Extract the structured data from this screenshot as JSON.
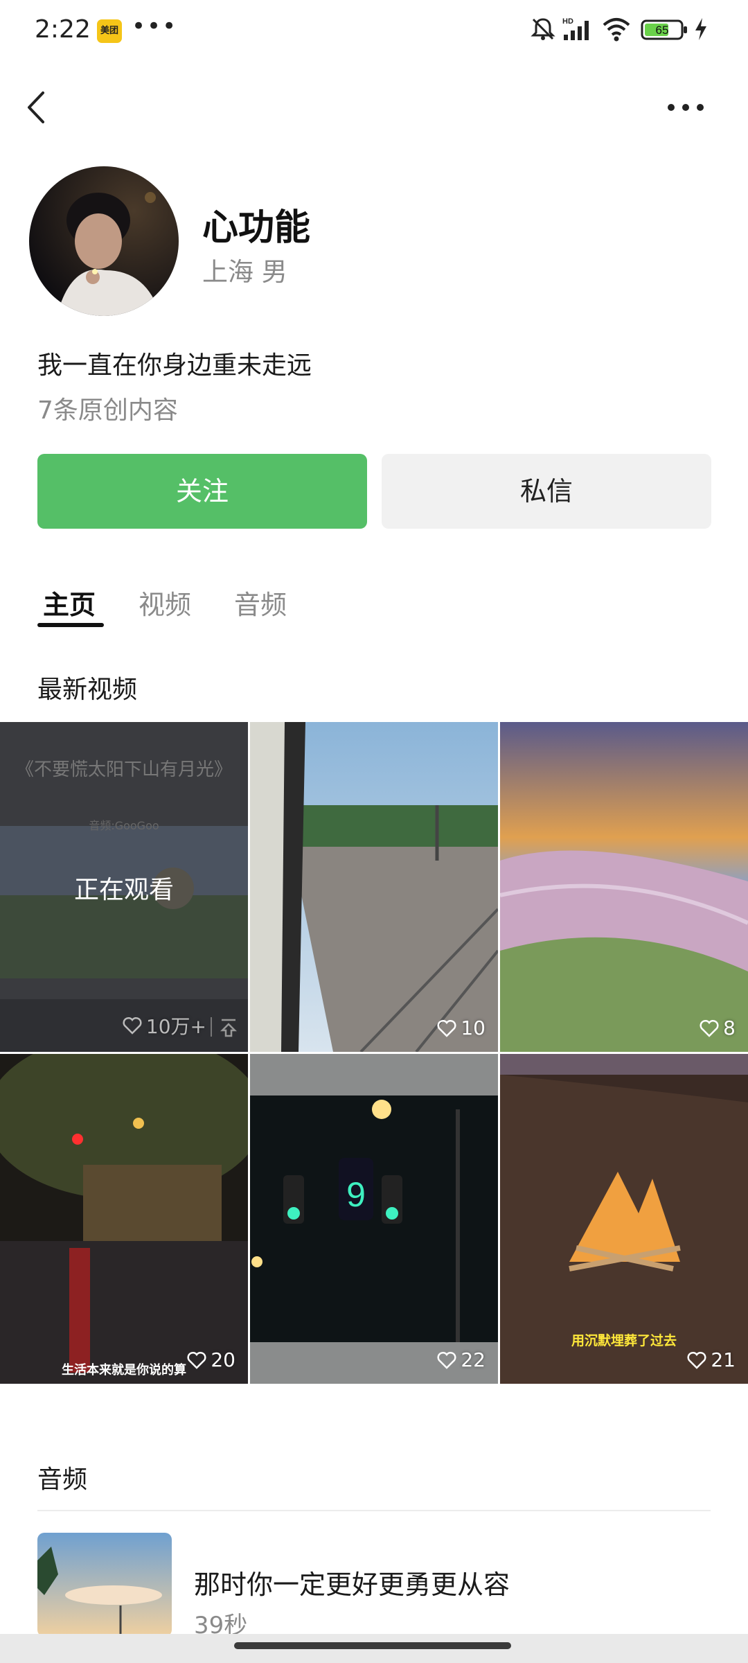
{
  "status_bar": {
    "time": "2:22",
    "app_badge": "美团",
    "battery": "65"
  },
  "profile": {
    "name": "心功能",
    "location": "上海 男",
    "bio": "我一直在你身边重未走远",
    "content_count": "7条原创内容"
  },
  "actions": {
    "follow": "关注",
    "message": "私信"
  },
  "tabs": [
    {
      "label": "主页",
      "active": true
    },
    {
      "label": "视频",
      "active": false
    },
    {
      "label": "音频",
      "active": false
    }
  ],
  "videos_section": {
    "title": "最新视频"
  },
  "videos": [
    {
      "likes": "10万+",
      "overlay": "正在观看",
      "title_text": "《不要慌太阳下山有月光》",
      "subtitle_text": "音频:GooGoo"
    },
    {
      "likes": "10"
    },
    {
      "likes": "8"
    },
    {
      "likes": "20",
      "caption": "生活本来就是你说的算"
    },
    {
      "likes": "22"
    },
    {
      "likes": "21",
      "caption": "用沉默埋葬了过去"
    }
  ],
  "audio_section": {
    "title": "音频"
  },
  "audio": [
    {
      "title": "那时你一定更好更勇更从容",
      "duration": "39秒"
    }
  ],
  "colors": {
    "follow_green": "#55bf67",
    "message_gray": "#f1f1f1"
  }
}
